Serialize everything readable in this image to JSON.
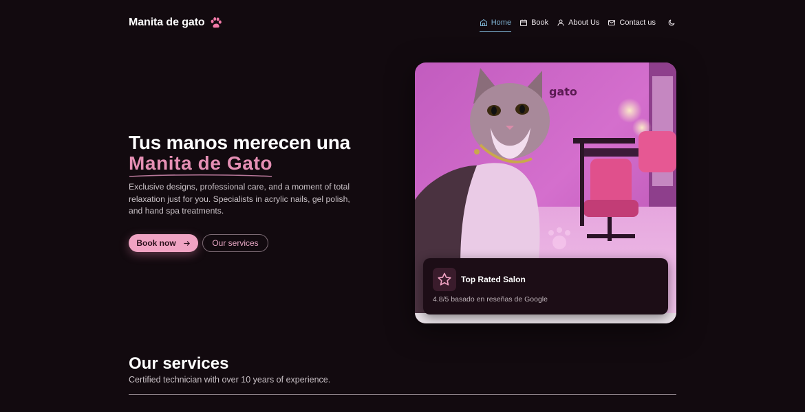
{
  "nav": {
    "brand": "Manita de gato",
    "items": [
      {
        "label": "Home",
        "icon": "home-icon",
        "active": true
      },
      {
        "label": "Book",
        "icon": "calendar-icon",
        "active": false
      },
      {
        "label": "About Us",
        "icon": "user-icon",
        "active": false
      },
      {
        "label": "Contact us",
        "icon": "mail-icon",
        "active": false
      }
    ],
    "theme_icon": "moon-icon"
  },
  "hero": {
    "title_line1": "Tus manos merecen una",
    "title_accent": "Manita de Gato",
    "description": "Exclusive designs, professional care, and a moment of total relaxation just for you. Specialists in acrylic nails, gel polish, and hand spa treatments.",
    "primary_button": "Book now",
    "secondary_button": "Our services"
  },
  "rating_card": {
    "title": "Top Rated Salon",
    "subtitle": "4.8/5 basado en reseñas de Google",
    "icon": "star-icon"
  },
  "services": {
    "title": "Our services",
    "subtitle": "Certified technician with over 10 years of experience."
  },
  "colors": {
    "background": "#120a0f",
    "accent_pink": "#e58fb4",
    "button_pink": "#f0a3c3",
    "nav_active": "#7fb4d4"
  }
}
